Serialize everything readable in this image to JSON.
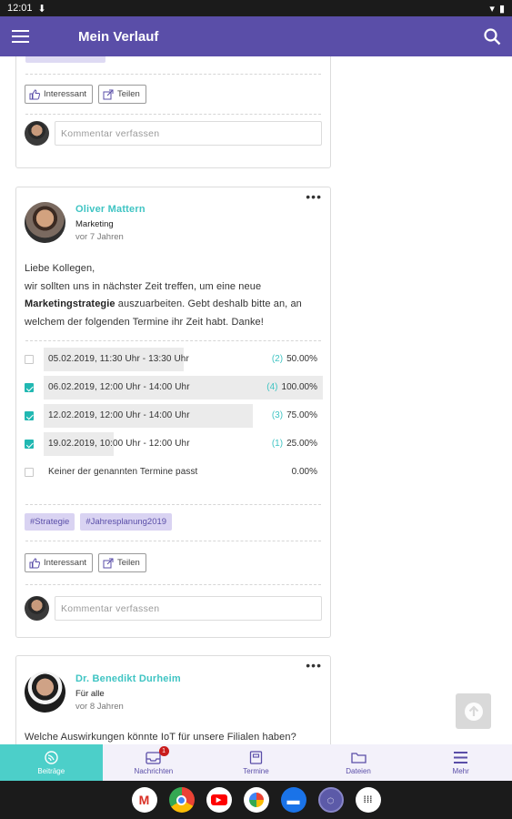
{
  "status_bar": {
    "time": "12:01"
  },
  "app_bar": {
    "title": "Mein Verlauf"
  },
  "card1": {
    "like_label": "Interessant",
    "share_label": "Teilen",
    "comment_placeholder": "Kommentar verfassen"
  },
  "card2": {
    "author": "Oliver Mattern",
    "group": "Marketing",
    "time_ago": "vor 7 Jahren",
    "text_line1": "Liebe Kollegen,",
    "text_line2": "wir sollten uns in nächster Zeit treffen, um eine neue",
    "text_bold": "Marketingstrategie",
    "text_line3_rest": " auszuarbeiten. Gebt deshalb bitte an, an",
    "text_line4": "welchem der folgenden Termine ihr Zeit habt. Danke!",
    "poll": [
      {
        "label": "05.02.2019, 11:30 Uhr - 13:30 Uhr",
        "checked": false,
        "count": "(2)",
        "percent": "50.00%",
        "fraction": 0.5
      },
      {
        "label": "06.02.2019, 12:00 Uhr - 14:00 Uhr",
        "checked": true,
        "count": "(4)",
        "percent": "100.00%",
        "fraction": 1.0
      },
      {
        "label": "12.02.2019, 12:00 Uhr - 14:00 Uhr",
        "checked": true,
        "count": "(3)",
        "percent": "75.00%",
        "fraction": 0.75
      },
      {
        "label": "19.02.2019, 10:00 Uhr - 12:00 Uhr",
        "checked": true,
        "count": "(1)",
        "percent": "25.00%",
        "fraction": 0.25
      },
      {
        "label": "Keiner der genannten Termine passt",
        "checked": false,
        "count": "",
        "percent": "0.00%",
        "fraction": 0
      }
    ],
    "tags": [
      "#Strategie",
      "#Jahresplanung2019"
    ],
    "like_label": "Interessant",
    "share_label": "Teilen",
    "comment_placeholder": "Kommentar verfassen"
  },
  "card3": {
    "author": "Dr. Benedikt Durheim",
    "group": "Für alle",
    "time_ago": "vor 8 Jahren",
    "text": "Welche Auswirkungen könnte IoT für unsere Filialen haben?"
  },
  "bottom_nav": [
    {
      "label": "Beiträge",
      "icon": "feed-icon",
      "active": true
    },
    {
      "label": "Nachrichten",
      "icon": "inbox-icon",
      "badge": "1"
    },
    {
      "label": "Termine",
      "icon": "calendar-icon"
    },
    {
      "label": "Dateien",
      "icon": "folder-icon"
    },
    {
      "label": "Mehr",
      "icon": "menu-icon"
    }
  ],
  "colors": {
    "primary": "#5a4ea8",
    "accent": "#3fc4c3",
    "active_nav": "#4ccfc9"
  },
  "dock_apps": [
    "gmail-icon",
    "chrome-icon",
    "youtube-icon",
    "photos-icon",
    "messages-icon",
    "assistant-icon",
    "app-drawer-icon"
  ]
}
